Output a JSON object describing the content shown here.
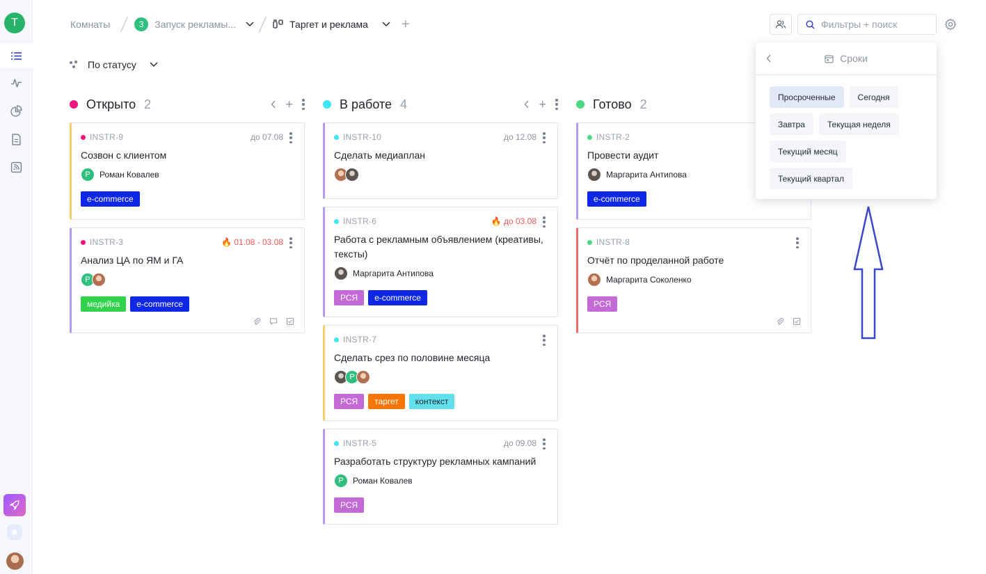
{
  "sidebar": {
    "workspace_initial": "T"
  },
  "breadcrumbs": {
    "root": "Комнаты",
    "project_number": "3",
    "project": "Запуск рекламы...",
    "board": "Таргет и реклама"
  },
  "search": {
    "placeholder": "Фильтры + поиск"
  },
  "groupby": {
    "label": "По статусу"
  },
  "colors": {
    "open": "#f0157a",
    "in_progress": "#3ee6f2",
    "done": "#4ed884",
    "accent": "#3a47c8"
  },
  "columns": [
    {
      "title": "Открыто",
      "count": "2",
      "cards": [
        {
          "key": "INSTR-9",
          "due": "до 07.08",
          "title": "Созвон с клиентом",
          "person": "Роман Ковалев",
          "avatar_letter": "Р",
          "tags": [
            "e-commerce"
          ]
        },
        {
          "key": "INSTR-3",
          "due": "01.08 - 03.08",
          "title": "Анализ ЦА по ЯМ и ГА",
          "avatar_letter": "Р",
          "tags": [
            "медийка",
            "e-commerce"
          ]
        }
      ]
    },
    {
      "title": "В работе",
      "count": "4",
      "cards": [
        {
          "key": "INSTR-10",
          "due": "до 12.08",
          "title": "Сделать медиаплан"
        },
        {
          "key": "INSTR-6",
          "due": "до 03.08",
          "title": "Работа с рекламным объявлением (креативы, тексты)",
          "person": "Маргарита Антипова",
          "tags": [
            "РСЯ",
            "e-commerce"
          ]
        },
        {
          "key": "INSTR-7",
          "title": "Сделать срез по половине месяца",
          "avatar_letter": "Р",
          "tags": [
            "РСЯ",
            "таргет",
            "контекст"
          ]
        },
        {
          "key": "INSTR-5",
          "due": "до 09.08",
          "title": "Разработать структуру рекламных кампаний",
          "person": "Роман Ковалев",
          "avatar_letter": "Р",
          "tags": [
            "РСЯ"
          ]
        }
      ]
    },
    {
      "title": "Готово",
      "count": "2",
      "cards": [
        {
          "key": "INSTR-2",
          "title": "Провести аудит",
          "person": "Маргарита Антипова",
          "tags": [
            "e-commerce"
          ]
        },
        {
          "key": "INSTR-8",
          "title": "Отчёт по проделанной работе",
          "person": "Маргарита Соколенко",
          "tags": [
            "РСЯ"
          ]
        }
      ]
    }
  ],
  "deadline_panel": {
    "title": "Сроки",
    "options": [
      "Просроченные",
      "Сегодня",
      "Завтра",
      "Текущая неделя",
      "Текущий месяц",
      "Текущий квартал"
    ],
    "selected": "Просроченные"
  }
}
